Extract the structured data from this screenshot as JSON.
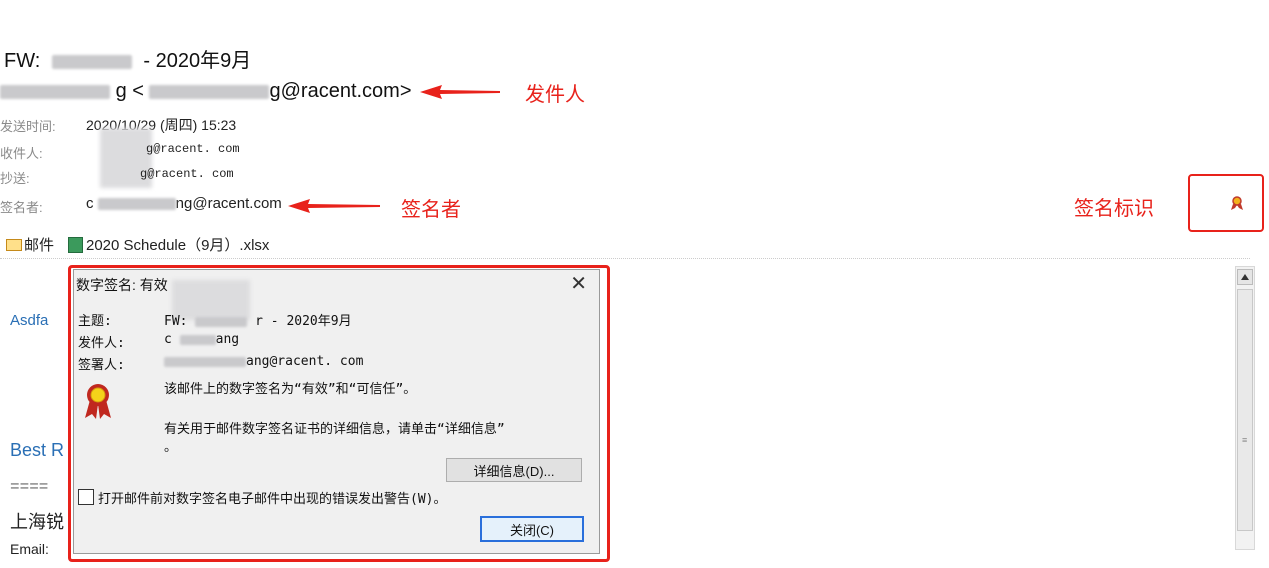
{
  "header": {
    "subject_prefix": "FW:",
    "subject_suffix": "- 2020年9月",
    "from_mid": "g <",
    "from_domain": "g@racent.com>",
    "meta": [
      {
        "label": "发送时间:",
        "value": "2020/10/29 (周四) 15:23"
      },
      {
        "label": "收件人:",
        "value": "g@racent. com"
      },
      {
        "label": "抄送:",
        "value": "g@racent. com"
      },
      {
        "label": "签名者:",
        "value": "ng@racent.com"
      }
    ],
    "signer_prefix": "c"
  },
  "annotations": {
    "sender": "发件人",
    "signer": "签名者",
    "sig_mark": "签名标识"
  },
  "attachments": {
    "mail_tab": "邮件",
    "file": "2020 Schedule（9月）.xlsx"
  },
  "body": {
    "greeting": "Asdfa",
    "best": "Best R",
    "rule": "====",
    "company": "上海锐",
    "email_label": "Email:"
  },
  "dialog": {
    "title": "数字签名: 有效",
    "close": "✕",
    "subject_label": "主题:",
    "subject_prefix": "FW:",
    "subject_suffix": "r - 2020年9月",
    "sender_label": "发件人:",
    "sender_value": "ang",
    "sender_prefix": "c",
    "signer_label": "签署人:",
    "signer_value": "ang@racent. com",
    "msg1": "该邮件上的数字签名为“有效”和“可信任”。",
    "msg2": "有关用于邮件数字签名证书的详细信息，请单击“详细信息”",
    "msg2_end": "。",
    "details_button": "详细信息(D)...",
    "checkbox_label": "打开邮件前对数字签名电子邮件中出现的错误发出警告(W)。",
    "close_button": "关闭(C)"
  },
  "colors": {
    "annotation_red": "#e8221b",
    "link_blue": "#2a6fb5"
  }
}
